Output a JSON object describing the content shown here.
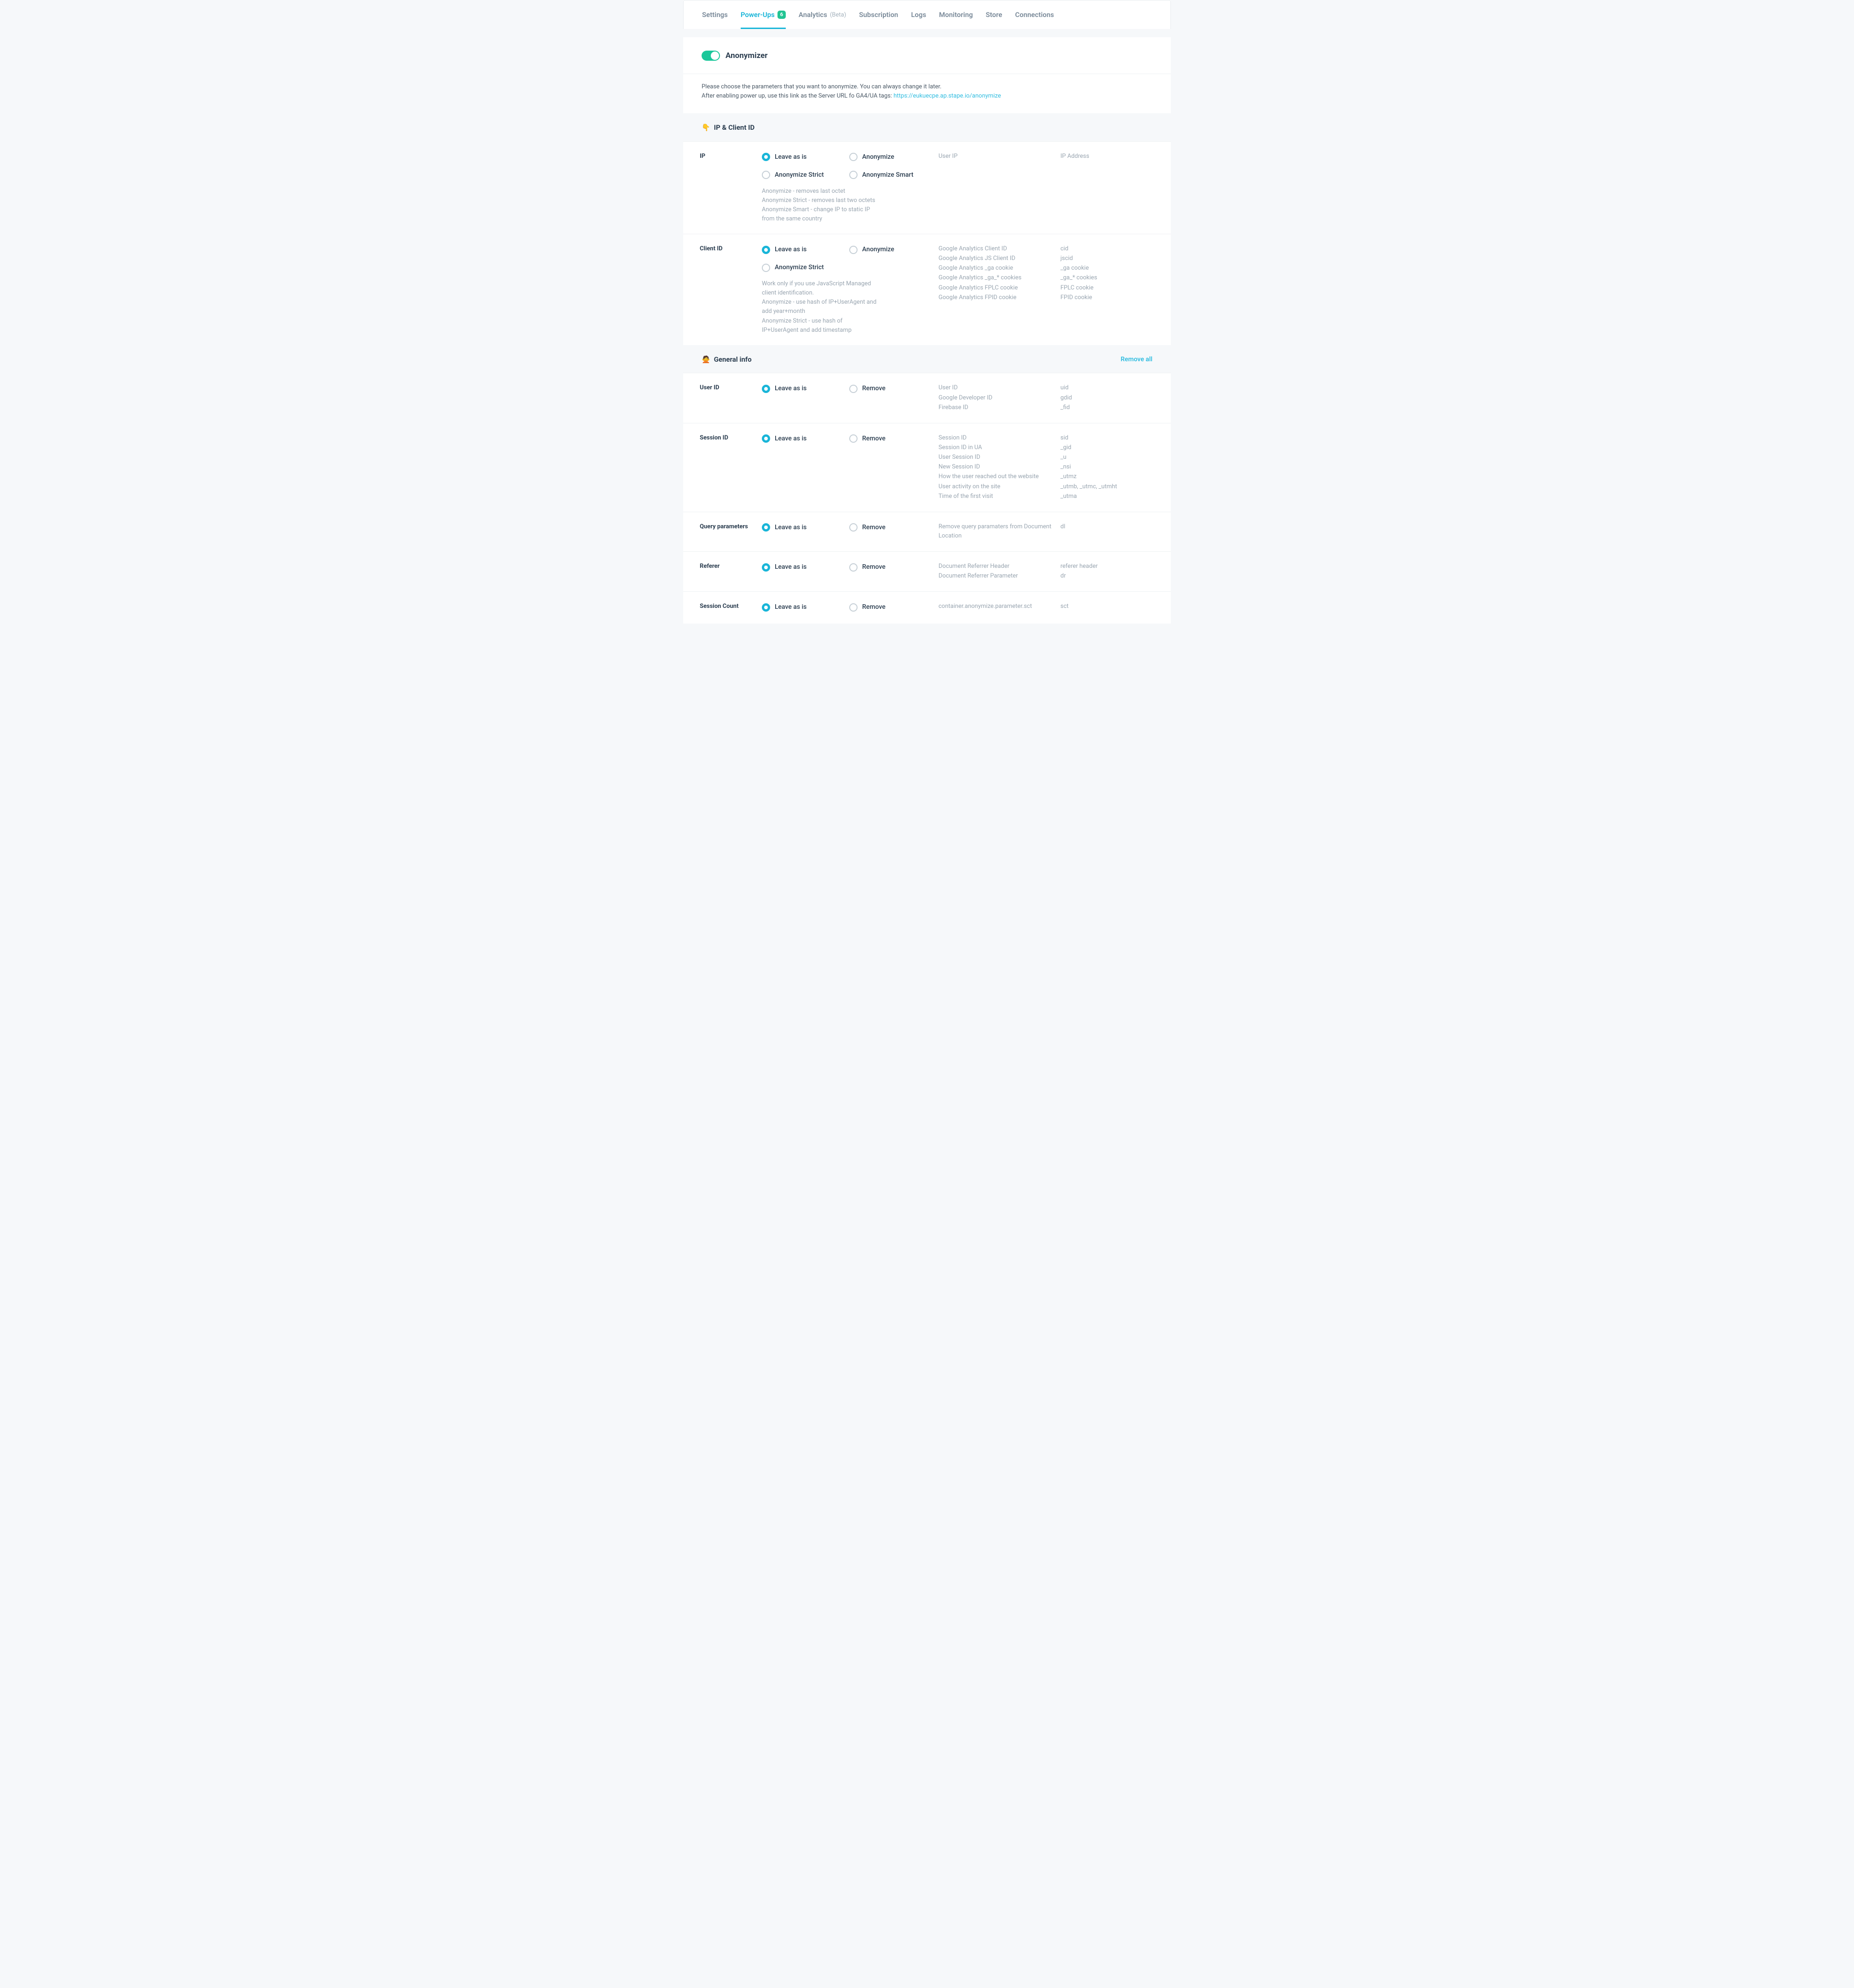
{
  "tabs": [
    {
      "label": "Settings",
      "active": false
    },
    {
      "label": "Power-Ups",
      "active": true,
      "badge": "6"
    },
    {
      "label": "Analytics",
      "beta": "(Beta)",
      "active": false
    },
    {
      "label": "Subscription",
      "active": false
    },
    {
      "label": "Logs",
      "active": false
    },
    {
      "label": "Monitoring",
      "active": false
    },
    {
      "label": "Store",
      "active": false
    },
    {
      "label": "Connections",
      "active": false
    }
  ],
  "header": {
    "title": "Anonymizer",
    "intro1": "Please choose the parameters that you want to anonymize. You can always change it later.",
    "intro2": "After enabling power up, use this link as the Server URL fo GA4/UA tags: ",
    "link": "https://eukuecpe.ap.stape.io/anonymize"
  },
  "section_ip": {
    "emoji": "👇",
    "title": "IP & Client ID"
  },
  "ip": {
    "title": "IP",
    "opts": [
      "Leave as is",
      "Anonymize",
      "Anonymize Strict",
      "Anonymize Smart"
    ],
    "selected": 0,
    "help": "Anonymize - removes last octet\nAnonymize Strict - removes last two octets\nAnonymize Smart - change IP to static IP from the same country",
    "col1": [
      "User IP"
    ],
    "col2": [
      "IP Address"
    ]
  },
  "cid": {
    "title": "Client ID",
    "opts": [
      "Leave as is",
      "Anonymize",
      "Anonymize Strict"
    ],
    "selected": 0,
    "help": "Work only if you use JavaScript Managed client identification.\nAnonymize - use hash of IP+UserAgent and add year+month\nAnonymize Strict - use hash of IP+UserAgent and add timestamp",
    "col1": [
      "Google Analytics Client ID",
      "Google Analytics JS Client ID",
      "Google Analytics _ga cookie",
      "Google Analytics _ga_* cookies",
      "Google Analytics FPLC cookie",
      "Google Analytics FPID cookie"
    ],
    "col2": [
      "cid",
      "jscid",
      "_ga cookie",
      "_ga_* cookies",
      "FPLC cookie",
      "FPID cookie"
    ]
  },
  "section_general": {
    "emoji": "🙅",
    "title": "General info",
    "remove_all": "Remove all"
  },
  "user_id": {
    "title": "User ID",
    "opts": [
      "Leave as is",
      "Remove"
    ],
    "selected": 0,
    "col1": [
      "User ID",
      "Google Developer ID",
      "Firebase ID"
    ],
    "col2": [
      "uid",
      "gdid",
      "_fid"
    ]
  },
  "session_id": {
    "title": "Session ID",
    "opts": [
      "Leave as is",
      "Remove"
    ],
    "selected": 0,
    "col1": [
      "Session ID",
      "Session ID in UA",
      "User Session ID",
      "New Session ID",
      "How the user reached out the website",
      "User activity on the site",
      "Time of the first visit"
    ],
    "col2": [
      "sid",
      "_gid",
      "_u",
      "_nsi",
      "_utmz",
      "_utmb, _utmc, _utmht",
      "_utma"
    ]
  },
  "qp": {
    "title": "Query parameters",
    "opts": [
      "Leave as is",
      "Remove"
    ],
    "selected": 0,
    "col1": [
      "Remove query paramaters from Document Location"
    ],
    "col2": [
      "dl"
    ]
  },
  "referer": {
    "title": "Referer",
    "opts": [
      "Leave as is",
      "Remove"
    ],
    "selected": 0,
    "col1": [
      "Document Referrer Header",
      "Document Referrer Parameter"
    ],
    "col2": [
      "referer header",
      "dr"
    ]
  },
  "sct": {
    "title": "Session Count",
    "opts": [
      "Leave as is",
      "Remove"
    ],
    "selected": 0,
    "col1": [
      "container.anonymize.parameter.sct"
    ],
    "col2": [
      "sct"
    ]
  }
}
